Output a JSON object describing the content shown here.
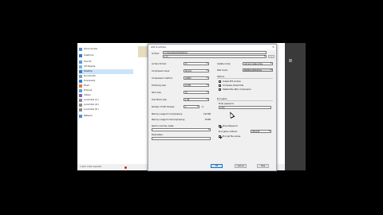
{
  "explorer": {
    "nav_items": [
      {
        "label": "Quick access",
        "color": "#4a90d9"
      },
      {
        "label": "OneDrive",
        "color": "#2f78c4"
      },
      {
        "label": "This PC",
        "color": "#5b9bd5"
      },
      {
        "label": "3D Objects",
        "color": "#6fb7e8"
      },
      {
        "label": "Desktop",
        "color": "#3b7fc4"
      },
      {
        "label": "Documents",
        "color": "#8a9bb0"
      },
      {
        "label": "Downloads",
        "color": "#2f7fd8"
      },
      {
        "label": "Music",
        "color": "#e07b39"
      },
      {
        "label": "Pictures",
        "color": "#5aa0d8"
      },
      {
        "label": "Videos",
        "color": "#7b61c9"
      },
      {
        "label": "Local Disk (C:)",
        "color": "#8a8a8a"
      },
      {
        "label": "Local Disk (D:)",
        "color": "#8a8a8a"
      },
      {
        "label": "Local Disk (E:)",
        "color": "#8a8a8a"
      },
      {
        "label": "Network",
        "color": "#4a90d9"
      }
    ],
    "status": "1 item    1 item selected"
  },
  "dialog": {
    "title": "Add to archive",
    "close_icon": "×",
    "archive_label": "Archive:",
    "archive_path": "C:\\Users\\Sapiens\\Desktop\\",
    "archive_name": "1.7z",
    "browse_label": "...",
    "left_rows": [
      {
        "label": "Archive format:",
        "value": "7z"
      },
      {
        "label": "Compression level:",
        "value": "Normal"
      },
      {
        "label": "Compression method:",
        "value": "LZMA2"
      },
      {
        "label": "Dictionary size:",
        "value": "16 MB"
      },
      {
        "label": "Word size:",
        "value": "32"
      },
      {
        "label": "Solid Block size:",
        "value": "2 GB"
      },
      {
        "label": "Number of CPU threads:",
        "value": "4"
      }
    ],
    "cpu_of": "/ 4",
    "memory_compress_label": "Memory usage for Compressing:",
    "memory_compress_value": "192 MB",
    "memory_decompress_label": "Memory usage for Decompressing:",
    "memory_decompress_value": "18 MB",
    "split_label": "Split to volumes, bytes:",
    "parameters_label": "Parameters:",
    "update_mode_label": "Update mode:",
    "update_mode_value": "Add and replace files",
    "path_mode_label": "Path mode:",
    "path_mode_value": "Relative pathnames",
    "options_label": "Options",
    "options": [
      {
        "label": "Create SFX archive",
        "checked": false
      },
      {
        "label": "Compress shared files",
        "checked": false
      },
      {
        "label": "Delete files after compression",
        "checked": false
      }
    ],
    "encryption_label": "Encryption",
    "enter_password_label": "Enter password:",
    "password_value": "1234",
    "show_password_label": "Show Password",
    "show_password_checked": true,
    "encryption_method_label": "Encryption method:",
    "encryption_method_value": "AES-256",
    "encrypt_names_label": "Encrypt file names",
    "encrypt_names_checked": true,
    "ok_label": "OK",
    "cancel_label": "Cancel",
    "help_label": "Help"
  }
}
